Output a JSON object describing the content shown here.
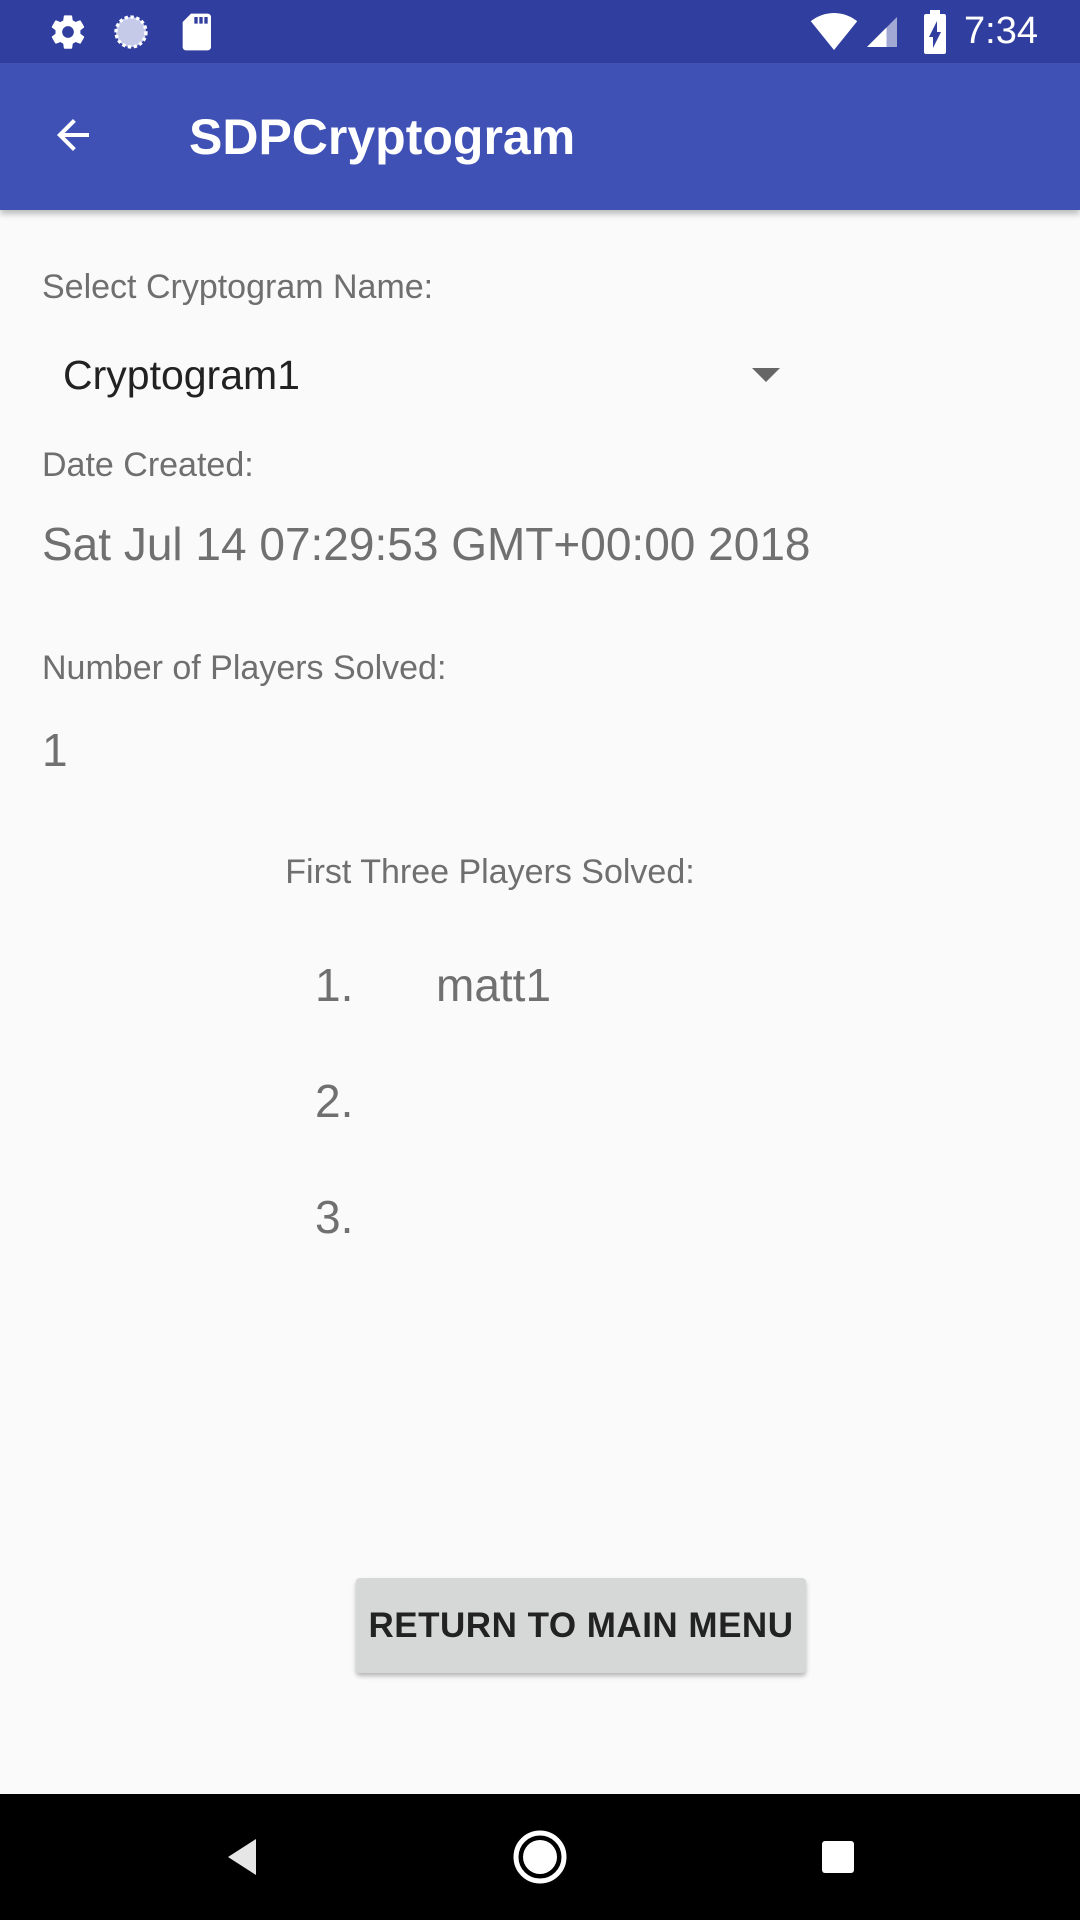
{
  "status_bar": {
    "time": "7:34",
    "icons": [
      "settings-icon",
      "sync-icon",
      "sd-card-icon",
      "wifi-icon",
      "signal-icon",
      "battery-charging-icon"
    ]
  },
  "app_bar": {
    "title": "SDPCryptogram",
    "back_icon": "arrow-back-icon"
  },
  "form": {
    "select_label": "Select Cryptogram Name:",
    "selected_cryptogram": "Cryptogram1",
    "date_label": "Date Created:",
    "date_value": "Sat Jul 14 07:29:53 GMT+00:00 2018",
    "players_solved_label": "Number of Players Solved:",
    "players_solved_value": "1",
    "first_three_label": "First Three Players Solved:",
    "ranking": [
      {
        "number": "1.",
        "name": "matt1"
      },
      {
        "number": "2.",
        "name": ""
      },
      {
        "number": "3.",
        "name": ""
      }
    ],
    "return_button_label": "RETURN TO MAIN MENU"
  },
  "nav_bar": {
    "icons": [
      "back-triangle-icon",
      "home-circle-icon",
      "recents-square-icon"
    ]
  },
  "colors": {
    "status_bar": "#303f9f",
    "app_bar": "#3f51b5",
    "background": "#fafafa",
    "button": "#d6d7d7"
  }
}
